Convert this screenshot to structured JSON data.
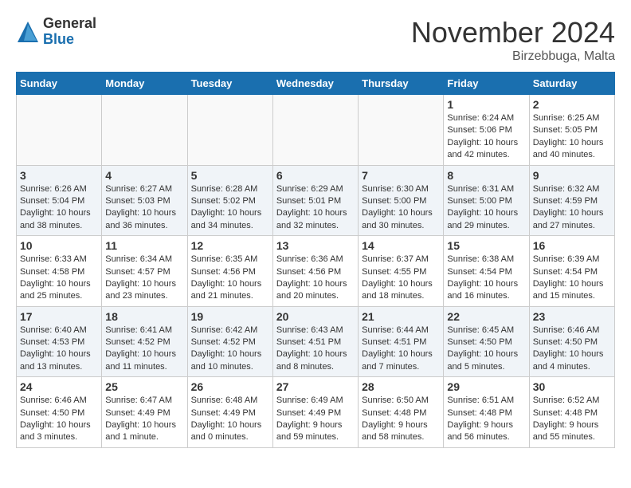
{
  "logo": {
    "general": "General",
    "blue": "Blue"
  },
  "header": {
    "month": "November 2024",
    "location": "Birzebbuga, Malta"
  },
  "days_of_week": [
    "Sunday",
    "Monday",
    "Tuesday",
    "Wednesday",
    "Thursday",
    "Friday",
    "Saturday"
  ],
  "weeks": [
    [
      {
        "day": "",
        "info": ""
      },
      {
        "day": "",
        "info": ""
      },
      {
        "day": "",
        "info": ""
      },
      {
        "day": "",
        "info": ""
      },
      {
        "day": "",
        "info": ""
      },
      {
        "day": "1",
        "info": "Sunrise: 6:24 AM\nSunset: 5:06 PM\nDaylight: 10 hours and 42 minutes."
      },
      {
        "day": "2",
        "info": "Sunrise: 6:25 AM\nSunset: 5:05 PM\nDaylight: 10 hours and 40 minutes."
      }
    ],
    [
      {
        "day": "3",
        "info": "Sunrise: 6:26 AM\nSunset: 5:04 PM\nDaylight: 10 hours and 38 minutes."
      },
      {
        "day": "4",
        "info": "Sunrise: 6:27 AM\nSunset: 5:03 PM\nDaylight: 10 hours and 36 minutes."
      },
      {
        "day": "5",
        "info": "Sunrise: 6:28 AM\nSunset: 5:02 PM\nDaylight: 10 hours and 34 minutes."
      },
      {
        "day": "6",
        "info": "Sunrise: 6:29 AM\nSunset: 5:01 PM\nDaylight: 10 hours and 32 minutes."
      },
      {
        "day": "7",
        "info": "Sunrise: 6:30 AM\nSunset: 5:00 PM\nDaylight: 10 hours and 30 minutes."
      },
      {
        "day": "8",
        "info": "Sunrise: 6:31 AM\nSunset: 5:00 PM\nDaylight: 10 hours and 29 minutes."
      },
      {
        "day": "9",
        "info": "Sunrise: 6:32 AM\nSunset: 4:59 PM\nDaylight: 10 hours and 27 minutes."
      }
    ],
    [
      {
        "day": "10",
        "info": "Sunrise: 6:33 AM\nSunset: 4:58 PM\nDaylight: 10 hours and 25 minutes."
      },
      {
        "day": "11",
        "info": "Sunrise: 6:34 AM\nSunset: 4:57 PM\nDaylight: 10 hours and 23 minutes."
      },
      {
        "day": "12",
        "info": "Sunrise: 6:35 AM\nSunset: 4:56 PM\nDaylight: 10 hours and 21 minutes."
      },
      {
        "day": "13",
        "info": "Sunrise: 6:36 AM\nSunset: 4:56 PM\nDaylight: 10 hours and 20 minutes."
      },
      {
        "day": "14",
        "info": "Sunrise: 6:37 AM\nSunset: 4:55 PM\nDaylight: 10 hours and 18 minutes."
      },
      {
        "day": "15",
        "info": "Sunrise: 6:38 AM\nSunset: 4:54 PM\nDaylight: 10 hours and 16 minutes."
      },
      {
        "day": "16",
        "info": "Sunrise: 6:39 AM\nSunset: 4:54 PM\nDaylight: 10 hours and 15 minutes."
      }
    ],
    [
      {
        "day": "17",
        "info": "Sunrise: 6:40 AM\nSunset: 4:53 PM\nDaylight: 10 hours and 13 minutes."
      },
      {
        "day": "18",
        "info": "Sunrise: 6:41 AM\nSunset: 4:52 PM\nDaylight: 10 hours and 11 minutes."
      },
      {
        "day": "19",
        "info": "Sunrise: 6:42 AM\nSunset: 4:52 PM\nDaylight: 10 hours and 10 minutes."
      },
      {
        "day": "20",
        "info": "Sunrise: 6:43 AM\nSunset: 4:51 PM\nDaylight: 10 hours and 8 minutes."
      },
      {
        "day": "21",
        "info": "Sunrise: 6:44 AM\nSunset: 4:51 PM\nDaylight: 10 hours and 7 minutes."
      },
      {
        "day": "22",
        "info": "Sunrise: 6:45 AM\nSunset: 4:50 PM\nDaylight: 10 hours and 5 minutes."
      },
      {
        "day": "23",
        "info": "Sunrise: 6:46 AM\nSunset: 4:50 PM\nDaylight: 10 hours and 4 minutes."
      }
    ],
    [
      {
        "day": "24",
        "info": "Sunrise: 6:46 AM\nSunset: 4:50 PM\nDaylight: 10 hours and 3 minutes."
      },
      {
        "day": "25",
        "info": "Sunrise: 6:47 AM\nSunset: 4:49 PM\nDaylight: 10 hours and 1 minute."
      },
      {
        "day": "26",
        "info": "Sunrise: 6:48 AM\nSunset: 4:49 PM\nDaylight: 10 hours and 0 minutes."
      },
      {
        "day": "27",
        "info": "Sunrise: 6:49 AM\nSunset: 4:49 PM\nDaylight: 9 hours and 59 minutes."
      },
      {
        "day": "28",
        "info": "Sunrise: 6:50 AM\nSunset: 4:48 PM\nDaylight: 9 hours and 58 minutes."
      },
      {
        "day": "29",
        "info": "Sunrise: 6:51 AM\nSunset: 4:48 PM\nDaylight: 9 hours and 56 minutes."
      },
      {
        "day": "30",
        "info": "Sunrise: 6:52 AM\nSunset: 4:48 PM\nDaylight: 9 hours and 55 minutes."
      }
    ]
  ]
}
